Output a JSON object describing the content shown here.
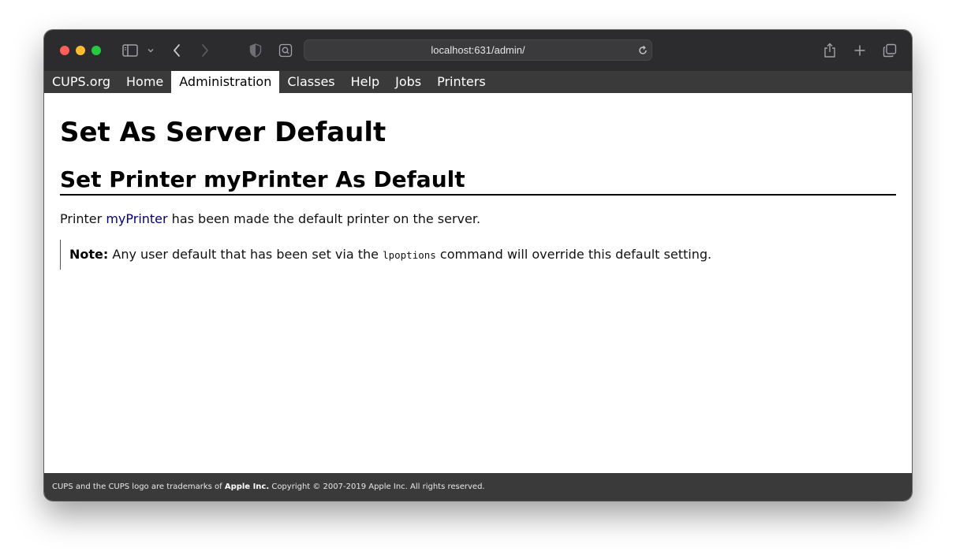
{
  "browser": {
    "address": "localhost:631/admin/",
    "icons": [
      "sidebar-icon",
      "chevron-down-icon",
      "back-icon",
      "forward-icon",
      "shield-icon",
      "reader-icon",
      "reload-icon",
      "share-icon",
      "new-tab-icon",
      "tabs-overview-icon"
    ]
  },
  "nav": {
    "items": [
      {
        "label": "CUPS.org"
      },
      {
        "label": "Home"
      },
      {
        "label": "Administration"
      },
      {
        "label": "Classes"
      },
      {
        "label": "Help"
      },
      {
        "label": "Jobs"
      },
      {
        "label": "Printers"
      }
    ],
    "active": "Administration"
  },
  "page": {
    "title": "Set As Server Default",
    "subtitle": "Set Printer myPrinter As Default",
    "message_prefix": "Printer ",
    "printer_link": "myPrinter",
    "message_suffix": " has been made the default printer on the server.",
    "note_label": "Note:",
    "note_prefix": " Any user default that has been set via the ",
    "note_command": "lpoptions",
    "note_suffix": " command will override this default setting."
  },
  "footer": {
    "prefix": "CUPS and the CUPS logo are trademarks of ",
    "company": "Apple Inc.",
    "suffix": " Copyright © 2007-2019 Apple Inc. All rights reserved."
  },
  "colors": {
    "titlebar": "#2c2c2e",
    "nav_background": "#3a3a3a",
    "link": "#000080"
  }
}
